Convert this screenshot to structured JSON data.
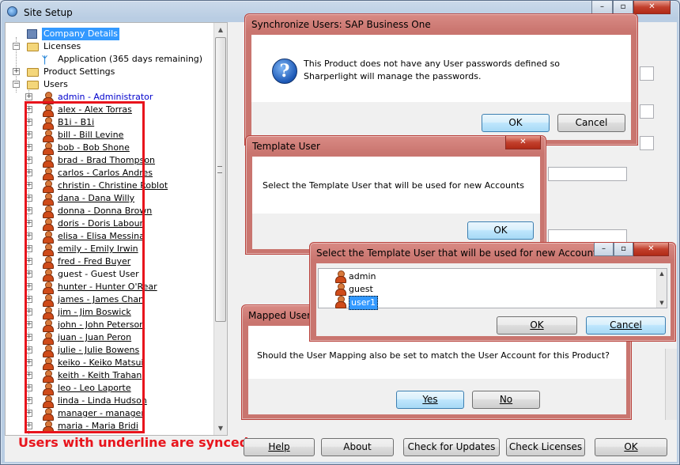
{
  "main_window": {
    "title": "Site Setup",
    "tree": {
      "company": "Company Details",
      "licenses": "Licenses",
      "application": "Application",
      "application_note": "(365 days remaining)",
      "product_settings": "Product Settings",
      "users_folder": "Users",
      "users": [
        {
          "label": "admin - Administrator",
          "synced": false,
          "selected_color": true
        },
        {
          "label": "alex - Alex Torras",
          "synced": true
        },
        {
          "label": "B1i - B1i",
          "synced": true
        },
        {
          "label": "bill - Bill Levine",
          "synced": true
        },
        {
          "label": "bob - Bob Shone",
          "synced": true
        },
        {
          "label": "brad - Brad Thompson",
          "synced": true
        },
        {
          "label": "carlos - Carlos Andres",
          "synced": true
        },
        {
          "label": "christin - Christine Roblot",
          "synced": true
        },
        {
          "label": "dana - Dana Willy",
          "synced": true
        },
        {
          "label": "donna - Donna Brown",
          "synced": true
        },
        {
          "label": "doris - Doris Labour",
          "synced": true
        },
        {
          "label": "elisa - Elisa Messina",
          "synced": true
        },
        {
          "label": "emily - Emily Irwin",
          "synced": true
        },
        {
          "label": "fred - Fred Buyer",
          "synced": true
        },
        {
          "label": "guest - Guest User",
          "synced": false
        },
        {
          "label": "hunter - Hunter O'Rear",
          "synced": true
        },
        {
          "label": "james - James Chan",
          "synced": true
        },
        {
          "label": "jim - Jim Boswick",
          "synced": true
        },
        {
          "label": "john - John Peterson",
          "synced": true
        },
        {
          "label": "juan - Juan Peron",
          "synced": true
        },
        {
          "label": "julie - Julie Bowens",
          "synced": true
        },
        {
          "label": "keiko - Keiko Matsui",
          "synced": true
        },
        {
          "label": "keith - Keith Trahan",
          "synced": true
        },
        {
          "label": "leo - Leo Laporte",
          "synced": true
        },
        {
          "label": "linda - Linda Hudson",
          "synced": true
        },
        {
          "label": "manager - manager",
          "synced": true
        },
        {
          "label": "maria - Maria Bridi",
          "synced": true
        }
      ]
    },
    "annotation": "Users with underline are synced",
    "annotation_color": "#e8141c",
    "buttons": {
      "help": "Help",
      "about": "About",
      "check_updates": "Check for Updates",
      "check_licenses": "Check Licenses",
      "ok": "OK"
    }
  },
  "sync_dialog": {
    "title": "Synchronize Users: SAP Business One",
    "message": "This Product does not have any User passwords defined so Sharperlight will manage the passwords.",
    "ok": "OK",
    "cancel": "Cancel",
    "icon": "question-icon"
  },
  "template_dialog": {
    "title": "Template User",
    "message": "Select the Template User that will be used for new Accounts",
    "ok": "OK"
  },
  "select_dialog": {
    "title": "Select the Template User that will be used for new Accounts",
    "items": [
      "admin",
      "guest",
      "user1"
    ],
    "selected": "user1",
    "ok": "OK",
    "cancel": "Cancel"
  },
  "mapped_dialog": {
    "title": "Mapped User",
    "message": "Should the User Mapping also be set to match the User Account for this Product?",
    "yes": "Yes",
    "no": "No"
  },
  "colors": {
    "selection": "#3399ff",
    "link_blue": "#0000cc",
    "highlight_box": "#e8141c"
  }
}
